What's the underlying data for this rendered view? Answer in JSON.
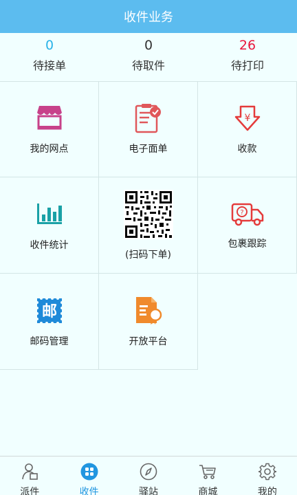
{
  "header": {
    "title": "收件业务"
  },
  "stats": [
    {
      "value": "0",
      "label": "待接单",
      "color": "#2ab3e8"
    },
    {
      "value": "0",
      "label": "待取件",
      "color": "#333333"
    },
    {
      "value": "26",
      "label": "待打印",
      "color": "#e8163c"
    }
  ],
  "grid": {
    "my_outlet": "我的网点",
    "e_waybill": "电子面单",
    "payment": "收款",
    "stats": "收件统计",
    "scan_order": "(扫码下单)",
    "parcel_tracking": "包裹跟踪",
    "postcode_mgmt": "邮码管理",
    "open_platform": "开放平台"
  },
  "stamp_char": "邮",
  "tabs": [
    {
      "label": "派件",
      "active": false
    },
    {
      "label": "收件",
      "active": true
    },
    {
      "label": "驿站",
      "active": false
    },
    {
      "label": "商城",
      "active": false
    },
    {
      "label": "我的",
      "active": false
    }
  ],
  "colors": {
    "header": "#5cbcef",
    "active_tab": "#2196e0",
    "background": "#f1ffff"
  }
}
